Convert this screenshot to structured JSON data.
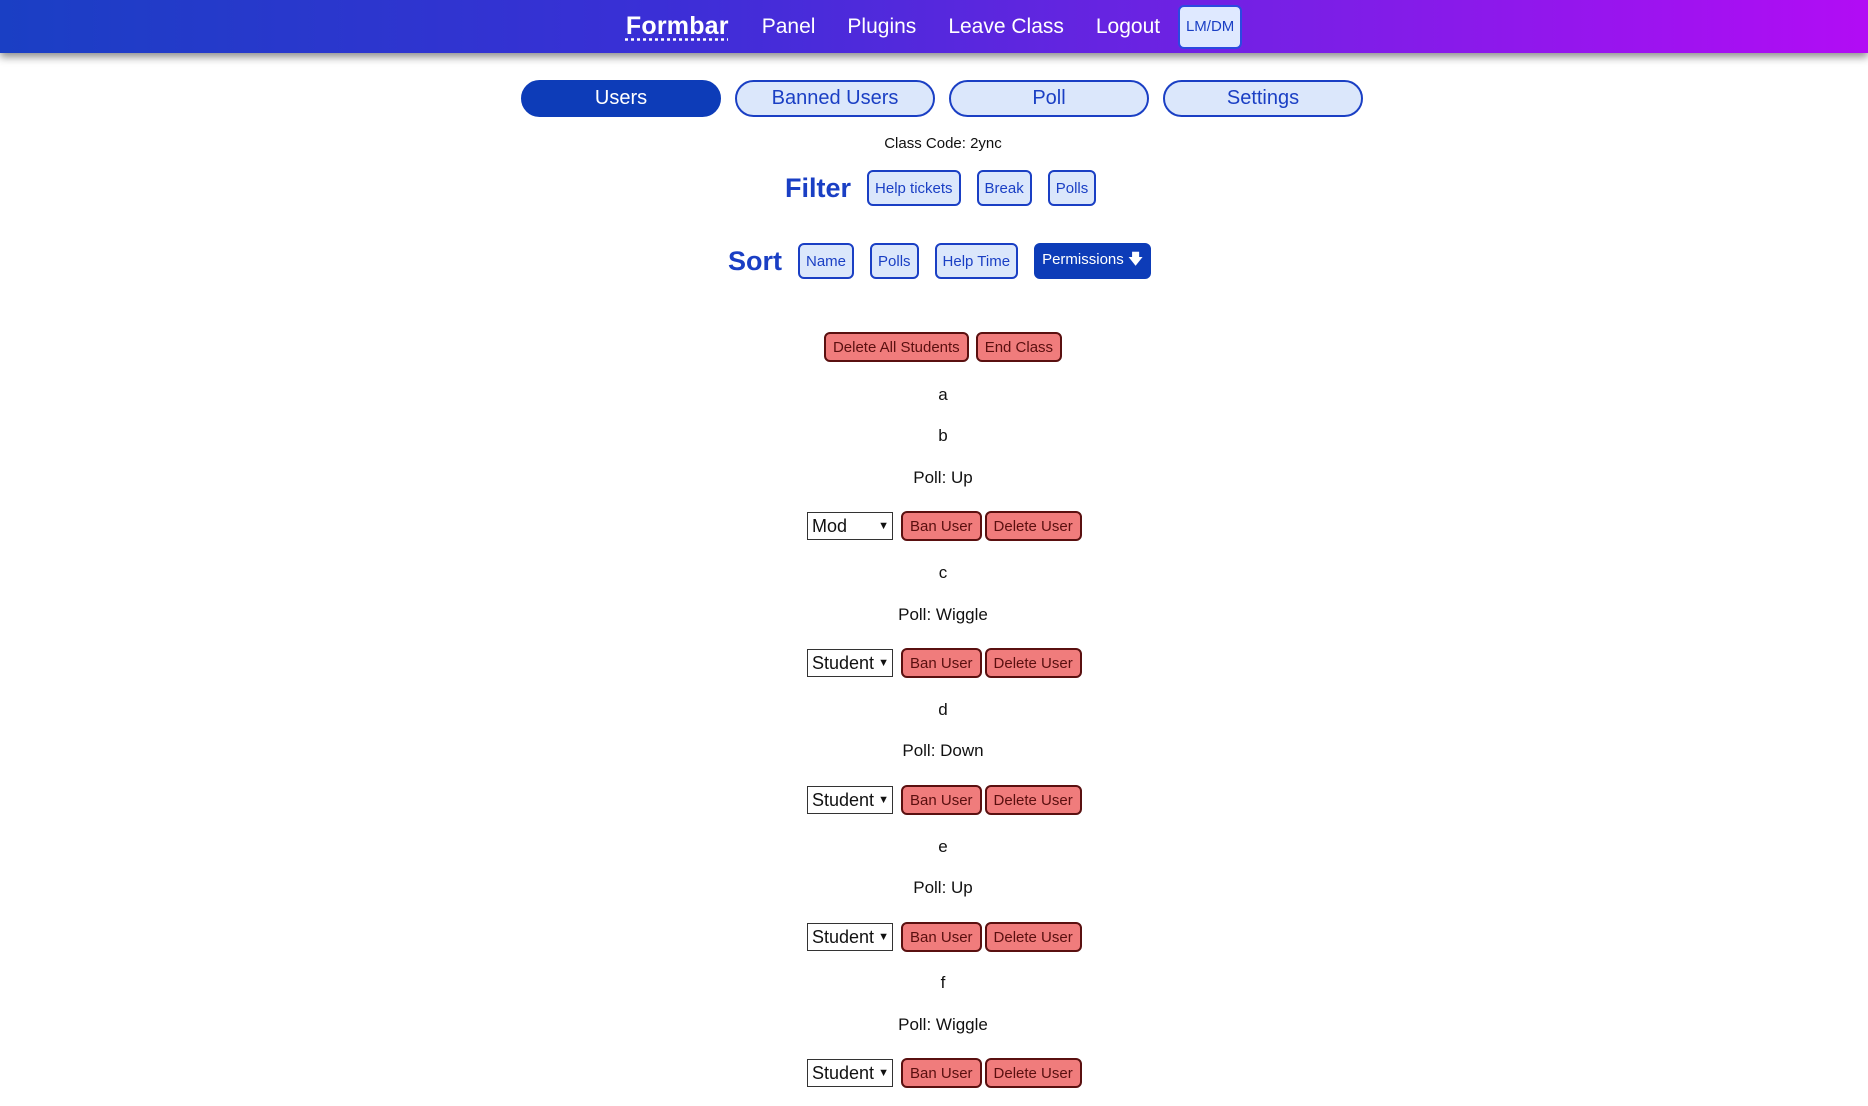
{
  "nav": {
    "brand": "Formbar",
    "links": [
      "Panel",
      "Plugins",
      "Leave Class",
      "Logout"
    ],
    "theme_button": "LM/DM"
  },
  "tabs": [
    {
      "label": "Users",
      "active": true
    },
    {
      "label": "Banned Users",
      "active": false
    },
    {
      "label": "Poll",
      "active": false
    },
    {
      "label": "Settings",
      "active": false
    }
  ],
  "class_code": "Class Code: 2ync",
  "filter": {
    "title": "Filter",
    "options": [
      "Help tickets",
      "Break",
      "Polls"
    ]
  },
  "sort": {
    "title": "Sort",
    "options": [
      "Name",
      "Polls",
      "Help Time"
    ],
    "active": "Permissions 🡇"
  },
  "actions": {
    "delete_all": "Delete All Students",
    "end_class": "End Class"
  },
  "users": {
    "a": "a",
    "b": {
      "name": "b",
      "poll": "Poll: Up",
      "perm": "Mod"
    },
    "c": {
      "name": "c",
      "poll": "Poll: Wiggle",
      "perm": "Student"
    },
    "d": {
      "name": "d",
      "poll": "Poll: Down",
      "perm": "Student"
    },
    "e": {
      "name": "e",
      "poll": "Poll: Up",
      "perm": "Student"
    },
    "f": {
      "name": "f",
      "poll": "Poll: Wiggle",
      "perm": "Student"
    }
  },
  "user_buttons": {
    "ban": "Ban User",
    "delete": "Delete User"
  },
  "colors": {
    "primary": "#1a3fc4",
    "active": "#0d3cb8",
    "danger_bg": "#f07c7c",
    "gradient_start": "#1a3fc4",
    "gradient_end": "#b20cf5"
  }
}
